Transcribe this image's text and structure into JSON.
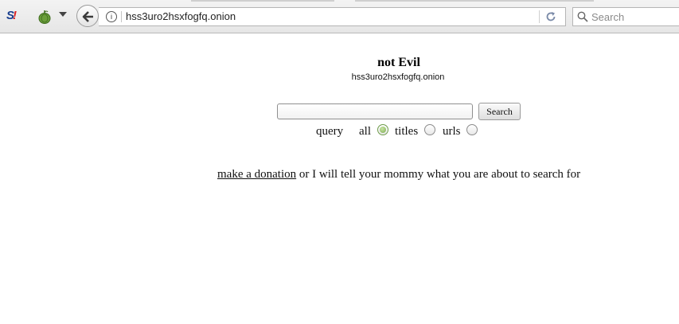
{
  "browser": {
    "url": "hss3uro2hsxfogfq.onion",
    "search_placeholder": "Search",
    "noscript_label": "S",
    "info_glyph": "i"
  },
  "page": {
    "title": "not Evil",
    "host": "hss3uro2hsxfogfq.onion",
    "search_button": "Search",
    "query_label": "query",
    "options": [
      {
        "label": "all",
        "checked": true
      },
      {
        "label": "titles",
        "checked": false
      },
      {
        "label": "urls",
        "checked": false
      }
    ],
    "donation_link": "make a donation",
    "donation_text": "or I will tell your mommy what you are about to search for"
  }
}
